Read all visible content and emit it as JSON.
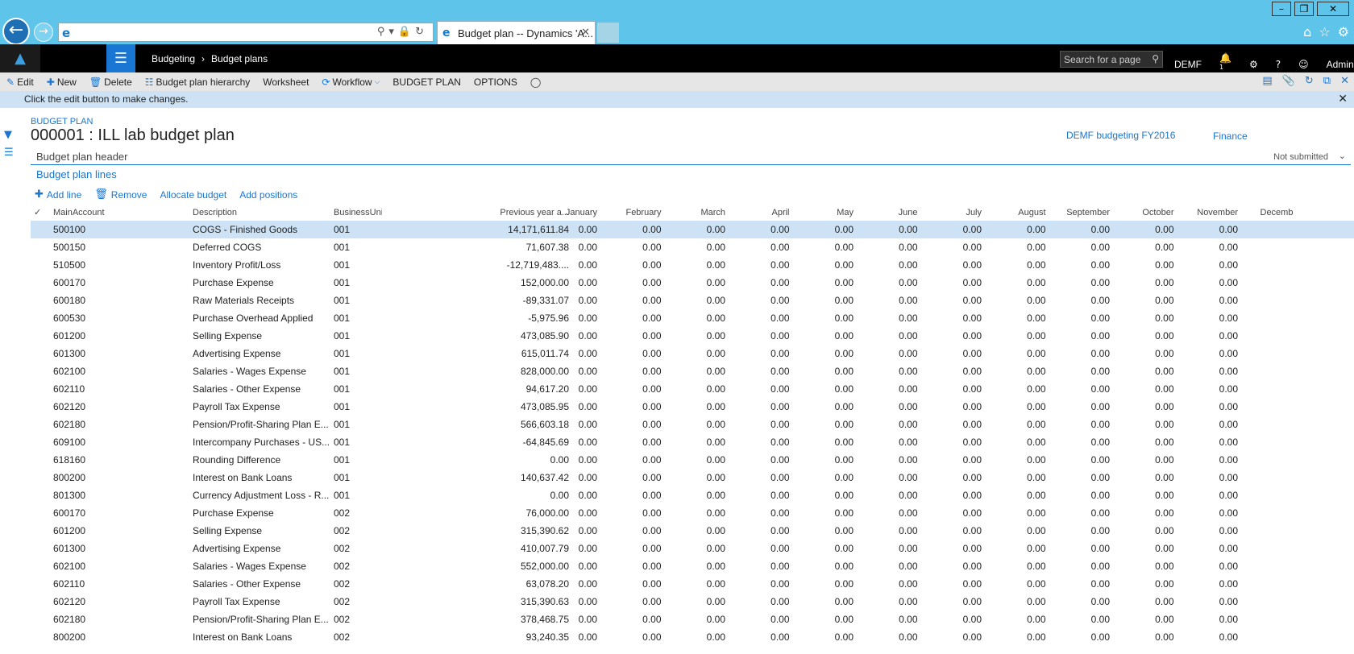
{
  "browser": {
    "tab_title": "Budget plan -- Dynamics 'A...",
    "address_value": "",
    "window_controls": [
      "minimize-icon",
      "restore-icon",
      "close-icon"
    ]
  },
  "app": {
    "breadcrumb": [
      "Budgeting",
      "Budget plans"
    ],
    "search_placeholder": "Search for a page",
    "company": "DEMF",
    "notification_count": "1",
    "user": "Admin"
  },
  "actions": {
    "edit": "Edit",
    "new": "New",
    "delete": "Delete",
    "hierarchy": "Budget plan hierarchy",
    "worksheet": "Worksheet",
    "workflow": "Workflow",
    "budget_plan": "BUDGET PLAN",
    "options": "OPTIONS"
  },
  "message": "Click the edit button to make changes.",
  "page": {
    "caption": "BUDGET PLAN",
    "title": "000001 : ILL lab budget plan",
    "cycle": "DEMF budgeting FY2016",
    "org": "Finance",
    "header_tab": "Budget plan header",
    "header_status": "Not submitted",
    "lines_title": "Budget plan lines"
  },
  "grid_actions": {
    "add_line": "Add line",
    "remove": "Remove",
    "allocate": "Allocate budget",
    "positions": "Add positions"
  },
  "columns": [
    "MainAccount",
    "Description",
    "BusinessUnit",
    "Previous year a...",
    "January",
    "February",
    "March",
    "April",
    "May",
    "June",
    "July",
    "August",
    "September",
    "October",
    "November",
    "Decemb"
  ],
  "rows": [
    {
      "acc": "500100",
      "desc": "COGS - Finished Goods",
      "bu": "001",
      "prev": "14,171,611.84"
    },
    {
      "acc": "500150",
      "desc": "Deferred COGS",
      "bu": "001",
      "prev": "71,607.38"
    },
    {
      "acc": "510500",
      "desc": "Inventory Profit/Loss",
      "bu": "001",
      "prev": "-12,719,483...."
    },
    {
      "acc": "600170",
      "desc": "Purchase Expense",
      "bu": "001",
      "prev": "152,000.00"
    },
    {
      "acc": "600180",
      "desc": "Raw Materials Receipts",
      "bu": "001",
      "prev": "-89,331.07"
    },
    {
      "acc": "600530",
      "desc": "Purchase Overhead Applied",
      "bu": "001",
      "prev": "-5,975.96"
    },
    {
      "acc": "601200",
      "desc": "Selling Expense",
      "bu": "001",
      "prev": "473,085.90"
    },
    {
      "acc": "601300",
      "desc": "Advertising Expense",
      "bu": "001",
      "prev": "615,011.74"
    },
    {
      "acc": "602100",
      "desc": "Salaries - Wages Expense",
      "bu": "001",
      "prev": "828,000.00"
    },
    {
      "acc": "602110",
      "desc": "Salaries - Other Expense",
      "bu": "001",
      "prev": "94,617.20"
    },
    {
      "acc": "602120",
      "desc": "Payroll Tax Expense",
      "bu": "001",
      "prev": "473,085.95"
    },
    {
      "acc": "602180",
      "desc": "Pension/Profit-Sharing Plan E...",
      "bu": "001",
      "prev": "566,603.18"
    },
    {
      "acc": "609100",
      "desc": "Intercompany Purchases - US...",
      "bu": "001",
      "prev": "-64,845.69"
    },
    {
      "acc": "618160",
      "desc": "Rounding Difference",
      "bu": "001",
      "prev": "0.00"
    },
    {
      "acc": "800200",
      "desc": "Interest on Bank Loans",
      "bu": "001",
      "prev": "140,637.42"
    },
    {
      "acc": "801300",
      "desc": "Currency Adjustment Loss - R...",
      "bu": "001",
      "prev": "0.00"
    },
    {
      "acc": "600170",
      "desc": "Purchase Expense",
      "bu": "002",
      "prev": "76,000.00"
    },
    {
      "acc": "601200",
      "desc": "Selling Expense",
      "bu": "002",
      "prev": "315,390.62"
    },
    {
      "acc": "601300",
      "desc": "Advertising Expense",
      "bu": "002",
      "prev": "410,007.79"
    },
    {
      "acc": "602100",
      "desc": "Salaries - Wages Expense",
      "bu": "002",
      "prev": "552,000.00"
    },
    {
      "acc": "602110",
      "desc": "Salaries - Other Expense",
      "bu": "002",
      "prev": "63,078.20"
    },
    {
      "acc": "602120",
      "desc": "Payroll Tax Expense",
      "bu": "002",
      "prev": "315,390.63"
    },
    {
      "acc": "602180",
      "desc": "Pension/Profit-Sharing Plan E...",
      "bu": "002",
      "prev": "378,468.75"
    },
    {
      "acc": "800200",
      "desc": "Interest on Bank Loans",
      "bu": "002",
      "prev": "93,240.35"
    }
  ],
  "month_value": "0.00"
}
